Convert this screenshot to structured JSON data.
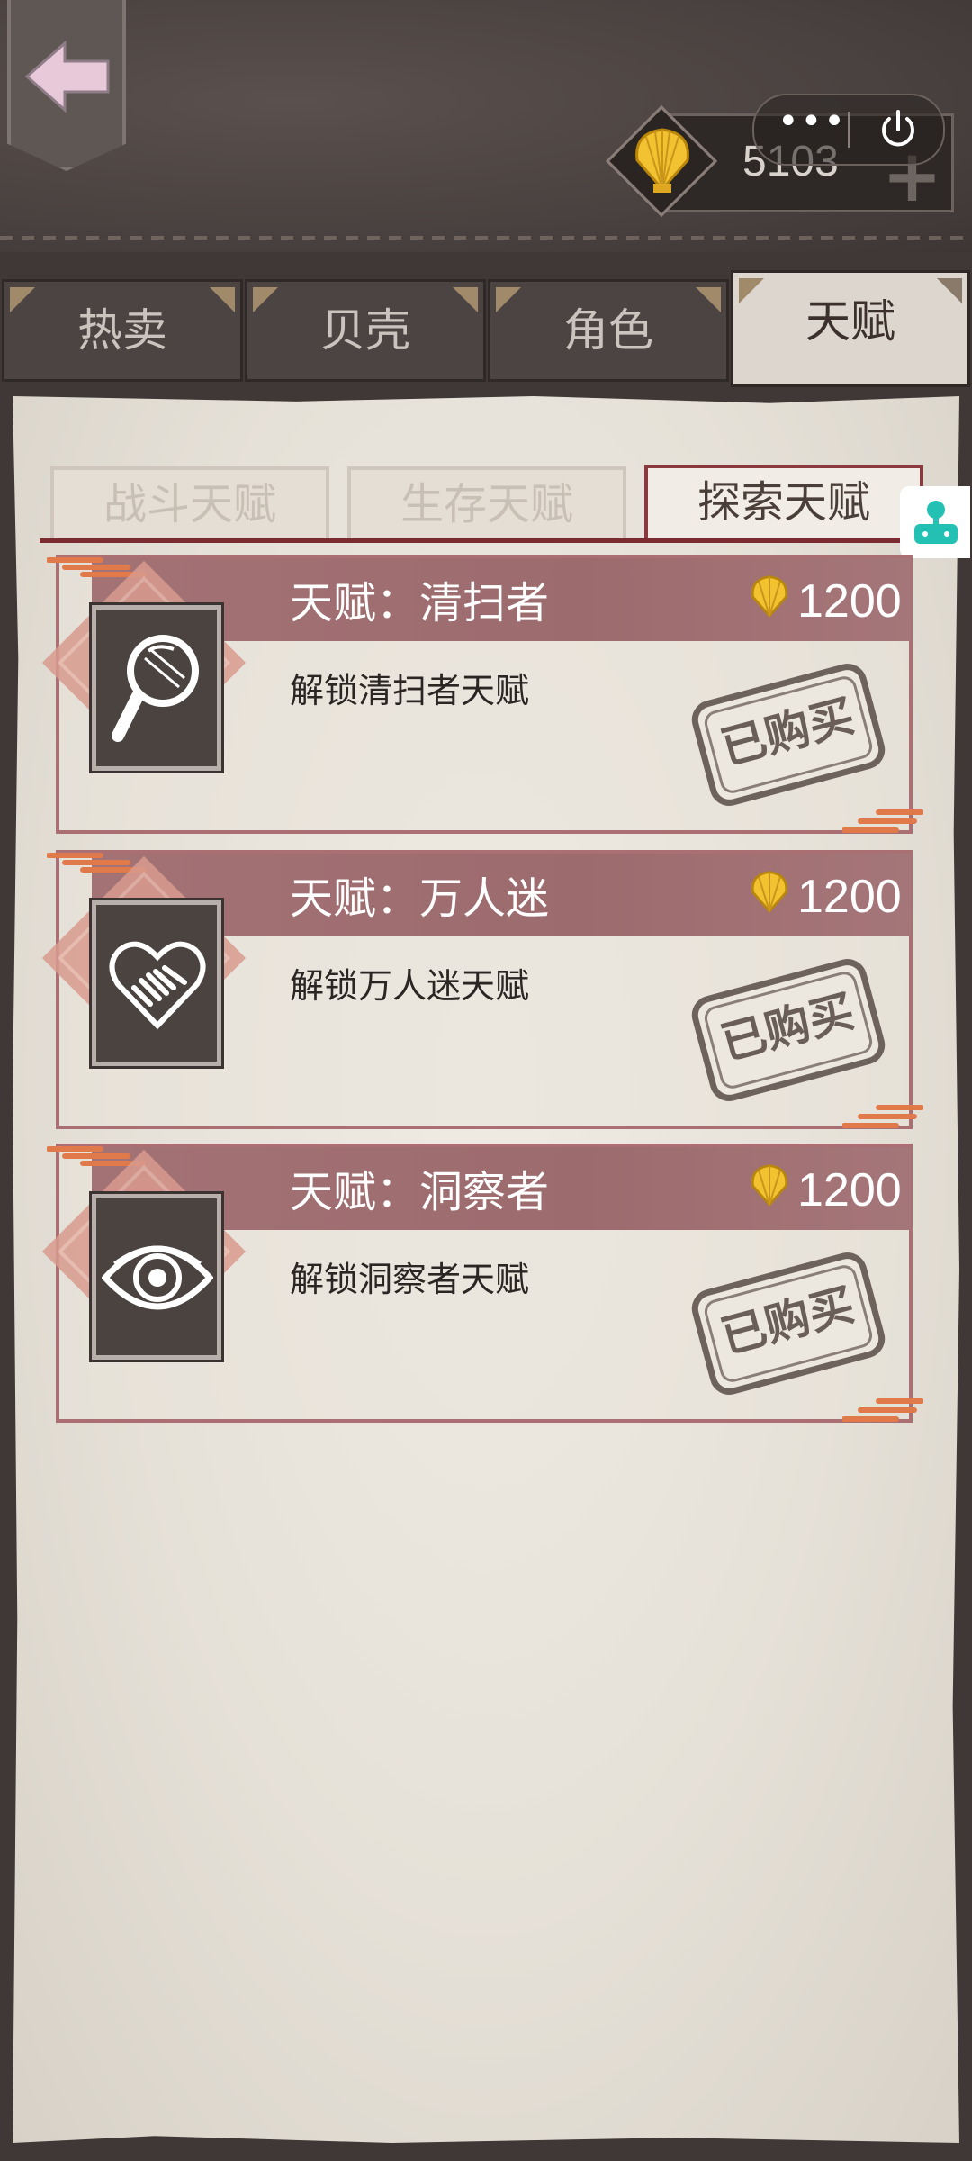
{
  "header": {
    "currency_amount": "5103",
    "capsule_dots": "•••"
  },
  "main_tabs": [
    {
      "label": "热卖",
      "active": false
    },
    {
      "label": "贝壳",
      "active": false
    },
    {
      "label": "角色",
      "active": false
    },
    {
      "label": "天赋",
      "active": true
    }
  ],
  "sub_tabs": [
    {
      "label": "战斗天赋",
      "active": false
    },
    {
      "label": "生存天赋",
      "active": false
    },
    {
      "label": "探索天赋",
      "active": true
    }
  ],
  "talents": [
    {
      "title": "天赋：清扫者",
      "price": "1200",
      "desc": "解锁清扫者天赋",
      "stamp": "已购买",
      "icon": "magnifier-icon"
    },
    {
      "title": "天赋：万人迷",
      "price": "1200",
      "desc": "解锁万人迷天赋",
      "stamp": "已购买",
      "icon": "heart-handshake-icon"
    },
    {
      "title": "天赋：洞察者",
      "price": "1200",
      "desc": "解锁洞察者天赋",
      "stamp": "已购买",
      "icon": "eye-icon"
    }
  ],
  "colors": {
    "accent_red": "#8a3a3e",
    "title_bar": "#a37275",
    "gold": "#f2c230"
  }
}
